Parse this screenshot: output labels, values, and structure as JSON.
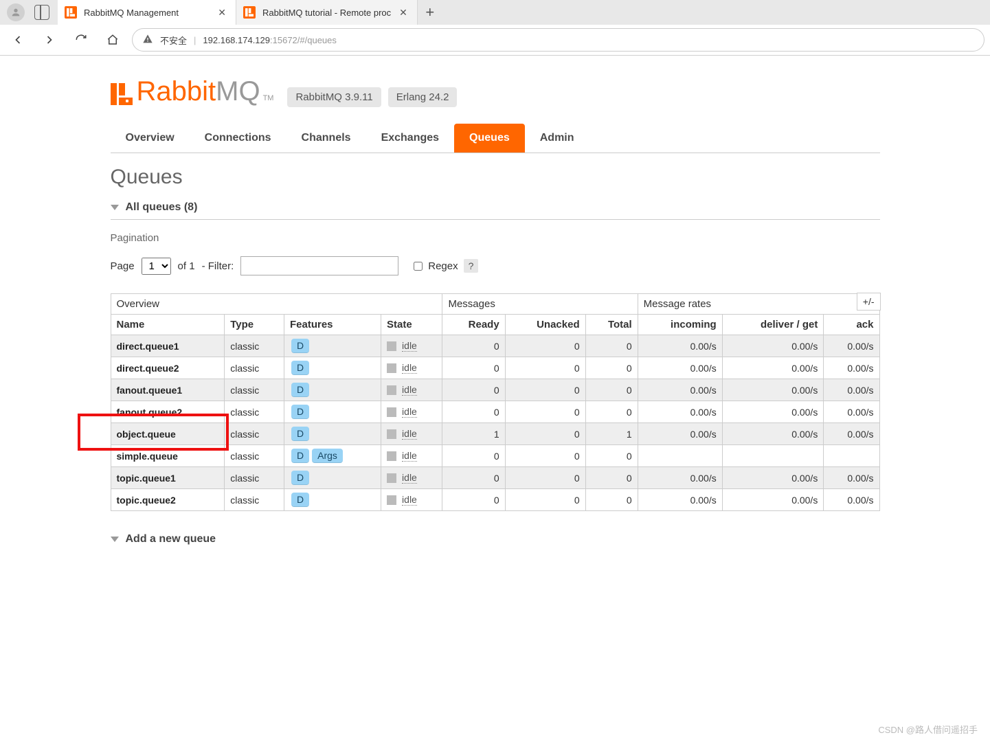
{
  "browser": {
    "tabs": [
      {
        "title": "RabbitMQ Management"
      },
      {
        "title": "RabbitMQ tutorial - Remote proc"
      }
    ],
    "address": {
      "insecure_label": "不安全",
      "url_plain": "192.168.174.129",
      "url_muted": ":15672/#/queues"
    }
  },
  "header": {
    "brand_text": "Rabbit",
    "brand_suffix": "MQ",
    "tm": "TM",
    "version_badge": "RabbitMQ 3.9.11",
    "erlang_badge": "Erlang 24.2"
  },
  "nav": {
    "items": [
      "Overview",
      "Connections",
      "Channels",
      "Exchanges",
      "Queues",
      "Admin"
    ],
    "active": "Queues"
  },
  "page": {
    "title": "Queues",
    "section_label": "All queues (8)",
    "pagination_label": "Pagination",
    "add_label": "Add a new queue"
  },
  "pager": {
    "page_label": "Page",
    "page_value": "1",
    "of_label": "of 1",
    "filter_label": "- Filter:",
    "regex_label": "Regex",
    "help": "?"
  },
  "table": {
    "group_headers": [
      "Overview",
      "Messages",
      "Message rates"
    ],
    "toggle": "+/-",
    "columns": [
      "Name",
      "Type",
      "Features",
      "State",
      "Ready",
      "Unacked",
      "Total",
      "incoming",
      "deliver / get",
      "ack"
    ],
    "rows": [
      {
        "name": "direct.queue1",
        "type": "classic",
        "features": [
          "D"
        ],
        "state": "idle",
        "ready": "0",
        "unacked": "0",
        "total": "0",
        "incoming": "0.00/s",
        "deliver": "0.00/s",
        "ack": "0.00/s"
      },
      {
        "name": "direct.queue2",
        "type": "classic",
        "features": [
          "D"
        ],
        "state": "idle",
        "ready": "0",
        "unacked": "0",
        "total": "0",
        "incoming": "0.00/s",
        "deliver": "0.00/s",
        "ack": "0.00/s"
      },
      {
        "name": "fanout.queue1",
        "type": "classic",
        "features": [
          "D"
        ],
        "state": "idle",
        "ready": "0",
        "unacked": "0",
        "total": "0",
        "incoming": "0.00/s",
        "deliver": "0.00/s",
        "ack": "0.00/s"
      },
      {
        "name": "fanout.queue2",
        "type": "classic",
        "features": [
          "D"
        ],
        "state": "idle",
        "ready": "0",
        "unacked": "0",
        "total": "0",
        "incoming": "0.00/s",
        "deliver": "0.00/s",
        "ack": "0.00/s"
      },
      {
        "name": "object.queue",
        "type": "classic",
        "features": [
          "D"
        ],
        "state": "idle",
        "ready": "1",
        "unacked": "0",
        "total": "1",
        "incoming": "0.00/s",
        "deliver": "0.00/s",
        "ack": "0.00/s"
      },
      {
        "name": "simple.queue",
        "type": "classic",
        "features": [
          "D",
          "Args"
        ],
        "state": "idle",
        "ready": "0",
        "unacked": "0",
        "total": "0",
        "incoming": "",
        "deliver": "",
        "ack": ""
      },
      {
        "name": "topic.queue1",
        "type": "classic",
        "features": [
          "D"
        ],
        "state": "idle",
        "ready": "0",
        "unacked": "0",
        "total": "0",
        "incoming": "0.00/s",
        "deliver": "0.00/s",
        "ack": "0.00/s"
      },
      {
        "name": "topic.queue2",
        "type": "classic",
        "features": [
          "D"
        ],
        "state": "idle",
        "ready": "0",
        "unacked": "0",
        "total": "0",
        "incoming": "0.00/s",
        "deliver": "0.00/s",
        "ack": "0.00/s"
      }
    ]
  },
  "watermark": "CSDN @路人借问遥招手"
}
